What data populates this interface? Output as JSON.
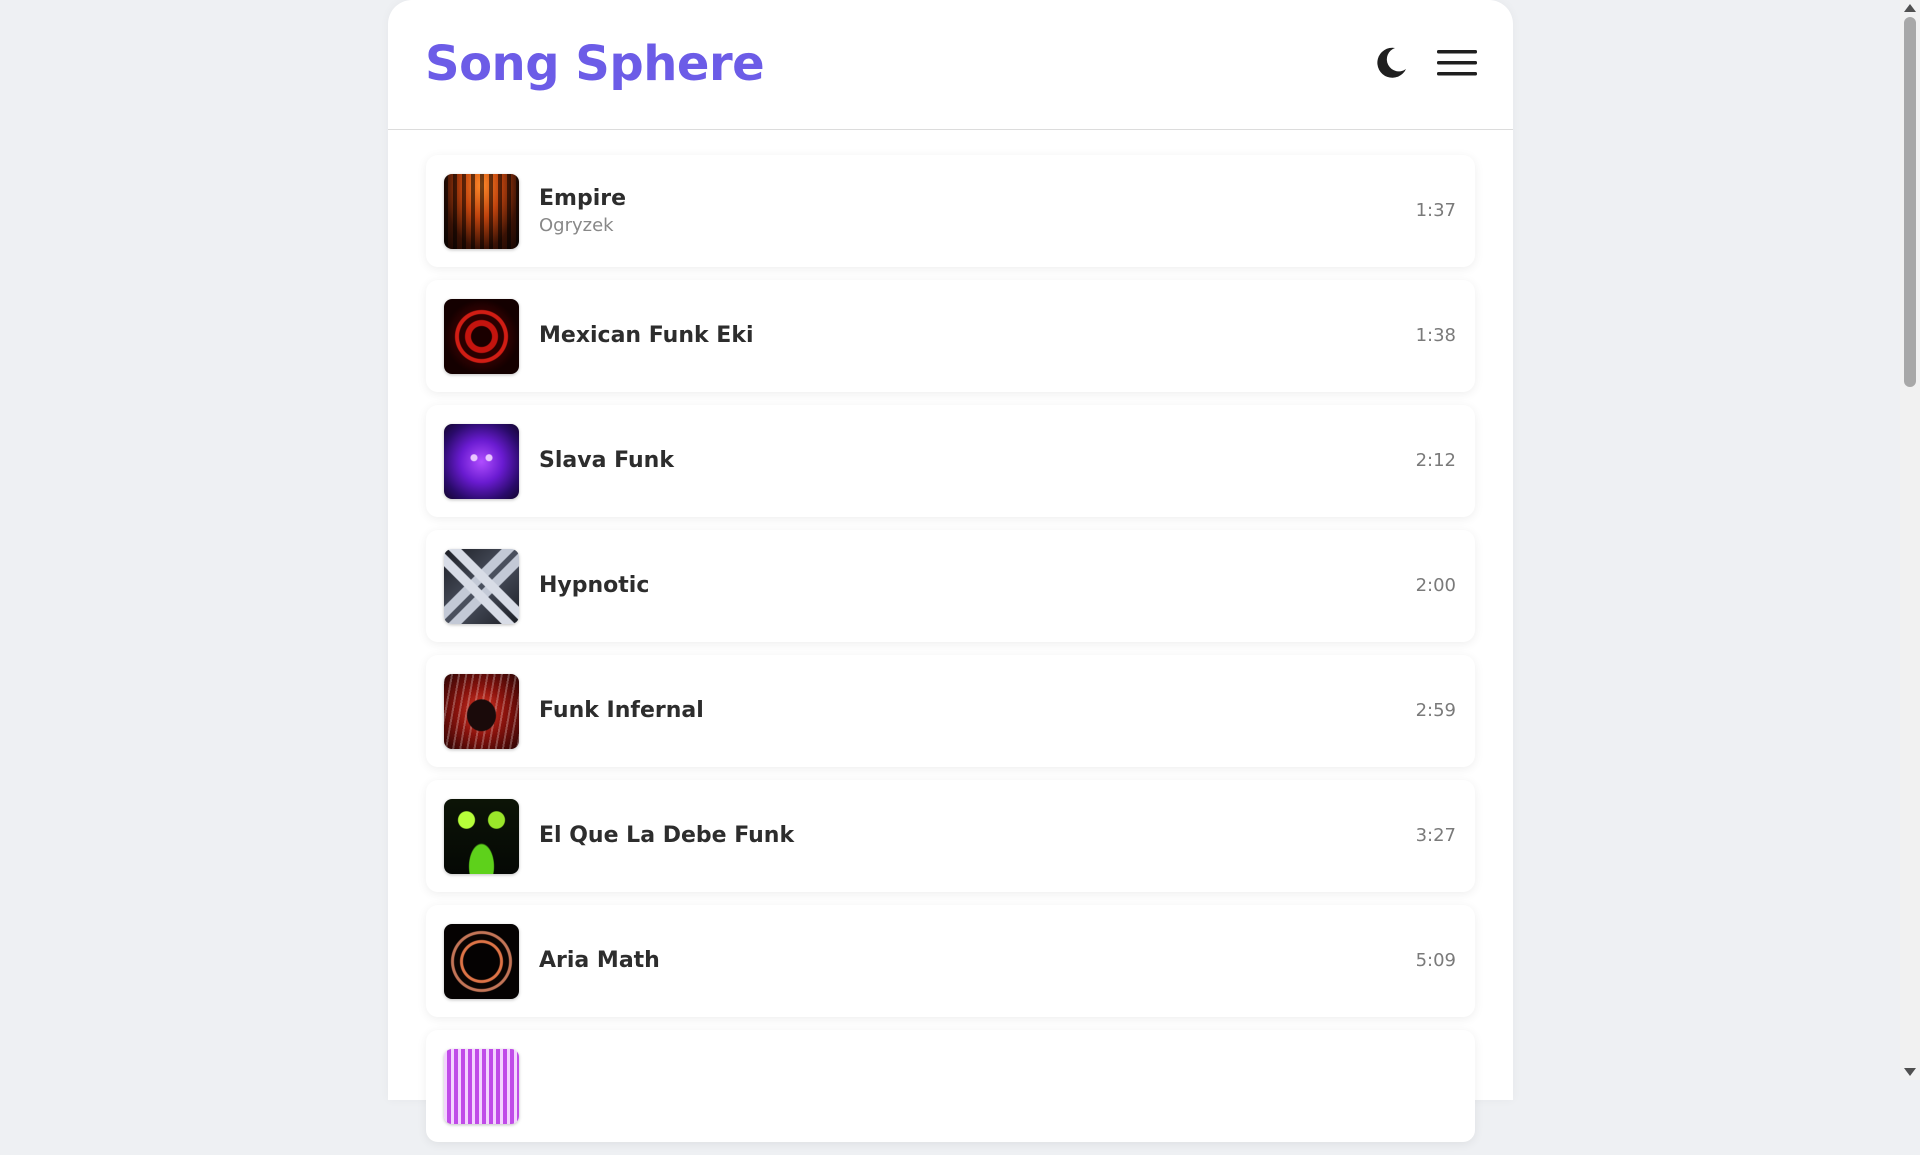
{
  "app": {
    "title": "Song Sphere",
    "accent_color": "#6c5ce7"
  },
  "header": {
    "theme_toggle_icon": "moon-icon",
    "menu_icon": "hamburger-menu-icon"
  },
  "tracks": [
    {
      "title": "Empire",
      "artist": "Ogryzek",
      "duration": "1:37"
    },
    {
      "title": "Mexican Funk Eki",
      "artist": "",
      "duration": "1:38"
    },
    {
      "title": "Slava Funk",
      "artist": "",
      "duration": "2:12"
    },
    {
      "title": "Hypnotic",
      "artist": "",
      "duration": "2:00"
    },
    {
      "title": "Funk Infernal",
      "artist": "",
      "duration": "2:59"
    },
    {
      "title": "El Que La Debe Funk",
      "artist": "",
      "duration": "3:27"
    },
    {
      "title": "Aria Math",
      "artist": "",
      "duration": "5:09"
    },
    {
      "title": "",
      "artist": "",
      "duration": ""
    }
  ]
}
